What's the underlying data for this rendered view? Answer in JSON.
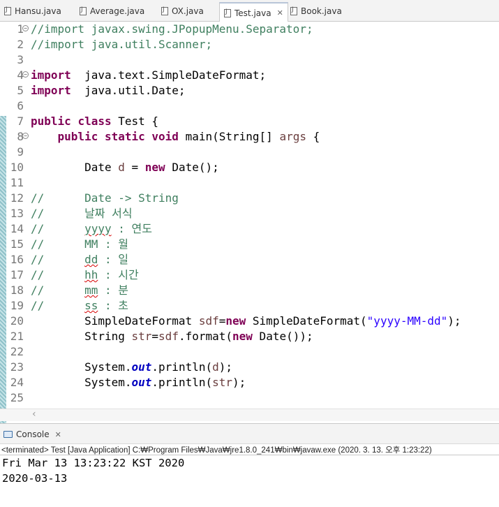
{
  "tabs": [
    {
      "label": "Hansu.java",
      "active": false
    },
    {
      "label": "Average.java",
      "active": false
    },
    {
      "label": "OX.java",
      "active": false
    },
    {
      "label": "Test.java",
      "active": true
    },
    {
      "label": "Book.java",
      "active": false
    }
  ],
  "editor": {
    "lines": [
      {
        "n": "1",
        "fold": true,
        "segs": [
          [
            "cm",
            "//import javax.swing.JPopupMenu.Separator;"
          ]
        ]
      },
      {
        "n": "2",
        "segs": [
          [
            "cm",
            "//import java.util.Scanner;"
          ]
        ]
      },
      {
        "n": "3",
        "segs": []
      },
      {
        "n": "4",
        "fold": true,
        "segs": [
          [
            "kw",
            "import"
          ],
          [
            "",
            "  java.text.SimpleDateFormat;"
          ]
        ]
      },
      {
        "n": "5",
        "segs": [
          [
            "kw",
            "import"
          ],
          [
            "",
            "  java.util.Date;"
          ]
        ]
      },
      {
        "n": "6",
        "segs": []
      },
      {
        "n": "7",
        "segs": [
          [
            "kw",
            "public"
          ],
          [
            "",
            " "
          ],
          [
            "kw",
            "class"
          ],
          [
            "",
            " Test {"
          ]
        ]
      },
      {
        "n": "8",
        "fold": true,
        "segs": [
          [
            "",
            "    "
          ],
          [
            "kw",
            "public"
          ],
          [
            "",
            " "
          ],
          [
            "kw",
            "static"
          ],
          [
            "",
            " "
          ],
          [
            "kw",
            "void"
          ],
          [
            "",
            " main(String[] "
          ],
          [
            "var",
            "args"
          ],
          [
            "",
            " {"
          ]
        ]
      },
      {
        "n": "9",
        "segs": []
      },
      {
        "n": "10",
        "segs": [
          [
            "",
            "        Date "
          ],
          [
            "var",
            "d"
          ],
          [
            "",
            " = "
          ],
          [
            "kw",
            "new"
          ],
          [
            "",
            " Date();"
          ]
        ]
      },
      {
        "n": "11",
        "segs": []
      },
      {
        "n": "12",
        "segs": [
          [
            "cm",
            "//      Date -> String"
          ]
        ]
      },
      {
        "n": "13",
        "segs": [
          [
            "cm",
            "//      날짜 서식"
          ]
        ]
      },
      {
        "n": "14",
        "segs": [
          [
            "cm",
            "//      "
          ],
          [
            "cm wavy",
            "yyyy"
          ],
          [
            "cm",
            " : 연도"
          ]
        ]
      },
      {
        "n": "15",
        "segs": [
          [
            "cm",
            "//      MM : 월"
          ]
        ]
      },
      {
        "n": "16",
        "segs": [
          [
            "cm",
            "//      "
          ],
          [
            "cm wavy",
            "dd"
          ],
          [
            "cm",
            " : 일"
          ]
        ]
      },
      {
        "n": "17",
        "segs": [
          [
            "cm",
            "//      "
          ],
          [
            "cm wavy",
            "hh"
          ],
          [
            "cm",
            " : 시간"
          ]
        ]
      },
      {
        "n": "18",
        "segs": [
          [
            "cm",
            "//      "
          ],
          [
            "cm wavy",
            "mm"
          ],
          [
            "cm",
            " : 분"
          ]
        ]
      },
      {
        "n": "19",
        "segs": [
          [
            "cm",
            "//      "
          ],
          [
            "cm wavy",
            "ss"
          ],
          [
            "cm",
            " : 초"
          ]
        ]
      },
      {
        "n": "20",
        "segs": [
          [
            "",
            "        SimpleDateFormat "
          ],
          [
            "var",
            "sdf"
          ],
          [
            "",
            "="
          ],
          [
            "kw",
            "new"
          ],
          [
            "",
            " SimpleDateFormat("
          ],
          [
            "str",
            "\"yyyy-MM-dd\""
          ],
          [
            "",
            ");"
          ]
        ]
      },
      {
        "n": "21",
        "segs": [
          [
            "",
            "        String "
          ],
          [
            "var",
            "str"
          ],
          [
            "",
            "="
          ],
          [
            "var",
            "sdf"
          ],
          [
            "",
            ".format("
          ],
          [
            "kw",
            "new"
          ],
          [
            "",
            " Date());"
          ]
        ]
      },
      {
        "n": "22",
        "segs": []
      },
      {
        "n": "23",
        "segs": [
          [
            "",
            "        System."
          ],
          [
            "stat",
            "out"
          ],
          [
            "",
            ".println("
          ],
          [
            "var",
            "d"
          ],
          [
            "",
            ");"
          ]
        ]
      },
      {
        "n": "24",
        "segs": [
          [
            "",
            "        System."
          ],
          [
            "stat",
            "out"
          ],
          [
            "",
            ".println("
          ],
          [
            "var",
            "str"
          ],
          [
            "",
            ");"
          ]
        ]
      },
      {
        "n": "25",
        "segs": []
      }
    ]
  },
  "console": {
    "tab_label": "Console",
    "status": "<terminated> Test [Java Application] C:₩Program Files₩Java₩jre1.8.0_241₩bin₩javaw.exe (2020. 3. 13. 오후 1:23:22)",
    "output": [
      "Fri Mar 13 13:23:22 KST 2020",
      "2020-03-13"
    ]
  }
}
